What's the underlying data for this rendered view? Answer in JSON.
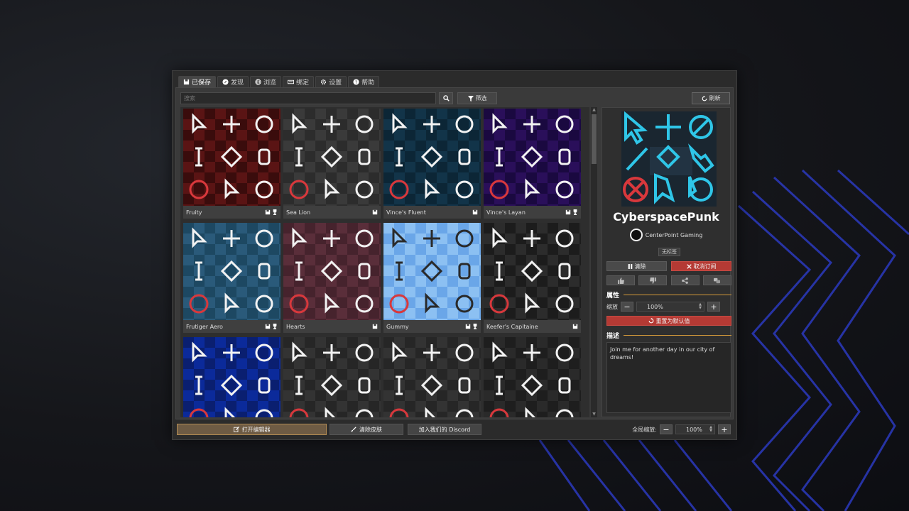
{
  "tabs": [
    {
      "label": "已保存",
      "icon": "save-icon",
      "active": true
    },
    {
      "label": "发现",
      "icon": "compass-icon",
      "active": false
    },
    {
      "label": "浏览",
      "icon": "globe-icon",
      "active": false
    },
    {
      "label": "绑定",
      "icon": "keyboard-icon",
      "active": false
    },
    {
      "label": "设置",
      "icon": "gear-icon",
      "active": false
    },
    {
      "label": "帮助",
      "icon": "help-icon",
      "active": false
    }
  ],
  "search": {
    "placeholder": "搜索",
    "value": ""
  },
  "toolbar": {
    "filter_label": "筛选",
    "refresh_label": "刷新"
  },
  "skins": [
    {
      "name": "Fruity",
      "theme": "#5a1414",
      "alt": "#3a0c0c",
      "save": true,
      "trophy": true
    },
    {
      "name": "Sea Lion",
      "theme": "#3a3a3a",
      "alt": "#2c2c2c",
      "save": true,
      "trophy": false
    },
    {
      "name": "Vince's Fluent",
      "theme": "#123449",
      "alt": "#0c2636",
      "save": true,
      "trophy": false
    },
    {
      "name": "Vince's Layan",
      "theme": "#2a0f5a",
      "alt": "#1a0940",
      "save": true,
      "trophy": true
    },
    {
      "name": "Frutiger Aero",
      "theme": "#2a5a7a",
      "alt": "#1d4862",
      "save": true,
      "trophy": true
    },
    {
      "name": "Hearts",
      "theme": "#5a2e3a",
      "alt": "#46232d",
      "save": true,
      "trophy": false
    },
    {
      "name": "Gummy",
      "theme": "#6aa6e8",
      "alt": "#8cc0f2",
      "save": true,
      "trophy": true
    },
    {
      "name": "Keefer's Capitaine",
      "theme": "#2c2c2c",
      "alt": "#1c1c1c",
      "save": true,
      "trophy": false
    },
    {
      "name": "",
      "theme": "#0b2a9a",
      "alt": "#0a1f70",
      "save": false,
      "trophy": false
    },
    {
      "name": "",
      "theme": "#333333",
      "alt": "#262626",
      "save": false,
      "trophy": false
    },
    {
      "name": "",
      "theme": "#333333",
      "alt": "#262626",
      "save": false,
      "trophy": false
    },
    {
      "name": "",
      "theme": "#2a2a2a",
      "alt": "#1e1e1e",
      "save": false,
      "trophy": false
    }
  ],
  "detail": {
    "title": "CyberspacePunk",
    "author": "CenterPoint Gaming",
    "tag": "无标签",
    "clear_label": "清除",
    "unsubscribe_label": "取消订阅",
    "properties_label": "属性",
    "zoom_label": "缩放",
    "zoom_value": "100%",
    "reset_label": "重置为默认值",
    "description_label": "描述",
    "description": "Join me for another day in our city of dreams!"
  },
  "bottom": {
    "open_editor": "打开编辑器",
    "clear_skin": "清除皮肤",
    "discord": "加入我们的 Discord",
    "global_zoom_label": "全局缩放:",
    "global_zoom_value": "100%"
  },
  "colors": {
    "accent_orange": "#d49a3a",
    "danger_red": "#b53a34",
    "cyber_cyan": "#2fc6e8"
  }
}
